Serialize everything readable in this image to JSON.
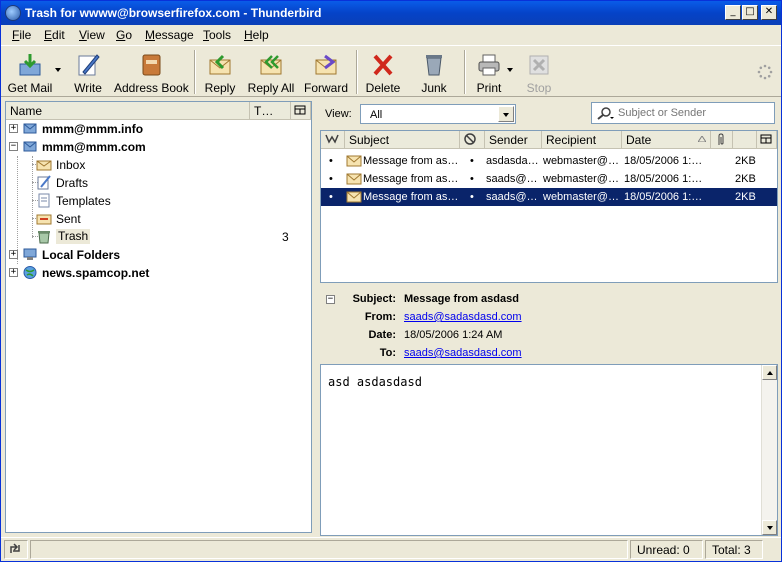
{
  "window": {
    "title": "Trash for wwww@browserfirefox.com - Thunderbird"
  },
  "menu": [
    {
      "label": "File",
      "key": "F",
      "rest": "ile"
    },
    {
      "label": "Edit",
      "key": "E",
      "rest": "dit"
    },
    {
      "label": "View",
      "key": "V",
      "rest": "iew"
    },
    {
      "label": "Go",
      "key": "G",
      "rest": "o"
    },
    {
      "label": "Message",
      "key": "M",
      "rest": "essage"
    },
    {
      "label": "Tools",
      "key": "T",
      "rest": "ools"
    },
    {
      "label": "Help",
      "key": "H",
      "rest": "elp"
    }
  ],
  "toolbar": {
    "get_mail": "Get Mail",
    "write": "Write",
    "address_book": "Address Book",
    "reply": "Reply",
    "reply_all": "Reply All",
    "forward": "Forward",
    "delete": "Delete",
    "junk": "Junk",
    "print": "Print",
    "stop": "Stop"
  },
  "folder_pane": {
    "col_name": "Name",
    "col_total": "T…",
    "accounts": [
      {
        "name": "mmm@mmm.info"
      },
      {
        "name": "mmm@mmm.com"
      },
      {
        "name": "Local Folders"
      },
      {
        "name": "news.spamcop.net"
      }
    ],
    "folders": [
      {
        "name": "Inbox",
        "count": ""
      },
      {
        "name": "Drafts",
        "count": ""
      },
      {
        "name": "Templates",
        "count": ""
      },
      {
        "name": "Sent",
        "count": ""
      },
      {
        "name": "Trash",
        "count": "3"
      }
    ]
  },
  "view_bar": {
    "label": "View:",
    "selected": "All",
    "search_placeholder": "Subject or Sender"
  },
  "thread_pane": {
    "columns": {
      "subject": "Subject",
      "sender": "Sender",
      "recipient": "Recipient",
      "date": "Date"
    },
    "rows": [
      {
        "subject": "Message from as…",
        "sender": "asdasda…",
        "recipient": "webmaster@…",
        "date": "18/05/2006 1:…",
        "size": "2KB"
      },
      {
        "subject": "Message from as…",
        "sender": "saads@…",
        "recipient": "webmaster@…",
        "date": "18/05/2006 1:…",
        "size": "2KB"
      },
      {
        "subject": "Message from as…",
        "sender": "saads@…",
        "recipient": "webmaster@…",
        "date": "18/05/2006 1:…",
        "size": "2KB"
      }
    ]
  },
  "message_header": {
    "subject_label": "Subject:",
    "subject": "Message from asdasd",
    "from_label": "From:",
    "from": "saads@sadasdasd.com",
    "date_label": "Date:",
    "date": "18/05/2006 1:24 AM",
    "to_label": "To:",
    "to": "saads@sadasdasd.com"
  },
  "message_body": {
    "text": "asd asdasdasd"
  },
  "status": {
    "unread": "Unread: 0",
    "total": "Total: 3"
  },
  "colors": {
    "titlebar": "#0a5ce8",
    "selection": "#0a246a",
    "link": "#0000ee"
  }
}
